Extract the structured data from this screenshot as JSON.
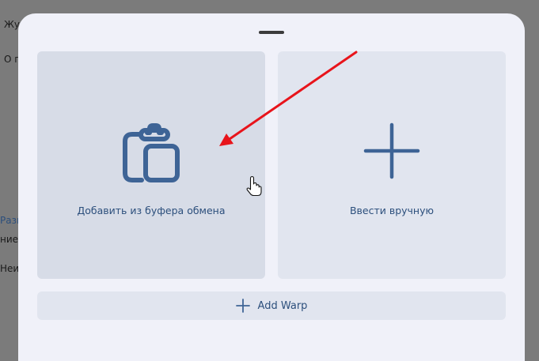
{
  "background": {
    "items": [
      "Жур",
      "О п",
      "Разв",
      "ние",
      "Неи"
    ]
  },
  "dialog": {
    "clipboard_card": {
      "label": "Добавить из буфера обмена",
      "icon": "clipboard-icon"
    },
    "manual_card": {
      "label": "Ввести вручную",
      "icon": "plus-icon"
    },
    "add_warp_button": {
      "label": "Add Warp",
      "icon": "plus-icon"
    }
  },
  "colors": {
    "accent": "#3e6496",
    "annotation_arrow": "#e8141b"
  }
}
